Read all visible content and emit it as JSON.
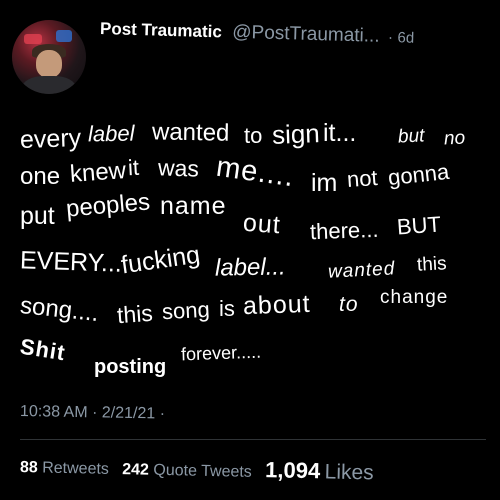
{
  "author": {
    "display_name": "Post Traumatic",
    "handle": "@PostTraumati...",
    "separator": "·",
    "age": "6d"
  },
  "tweet": {
    "lines": [
      [
        "every",
        "label",
        "wanted",
        "to",
        "sign",
        "it...",
        "but",
        "no"
      ],
      [
        "one",
        "knew",
        "it",
        "was",
        "me....",
        "im",
        "not",
        "gonna"
      ],
      [
        "put",
        "peoples",
        "name",
        "out",
        "there...",
        "BUT"
      ],
      [
        "EVERY...",
        "fucking",
        "label...",
        "wanted",
        "this"
      ],
      [
        "song....",
        "this",
        "song",
        "is",
        "about",
        "to",
        "change"
      ],
      [
        "Shit",
        "posting",
        "forever....."
      ]
    ]
  },
  "meta": {
    "time": "10:38 AM",
    "separator": "·",
    "date": "2/21/21",
    "trail": "·"
  },
  "stats": {
    "retweets_count": "88",
    "retweets_label": "Retweets",
    "quotes_count": "242",
    "quotes_label": "Quote Tweets",
    "likes_count": "1,094",
    "likes_label": "Likes"
  }
}
